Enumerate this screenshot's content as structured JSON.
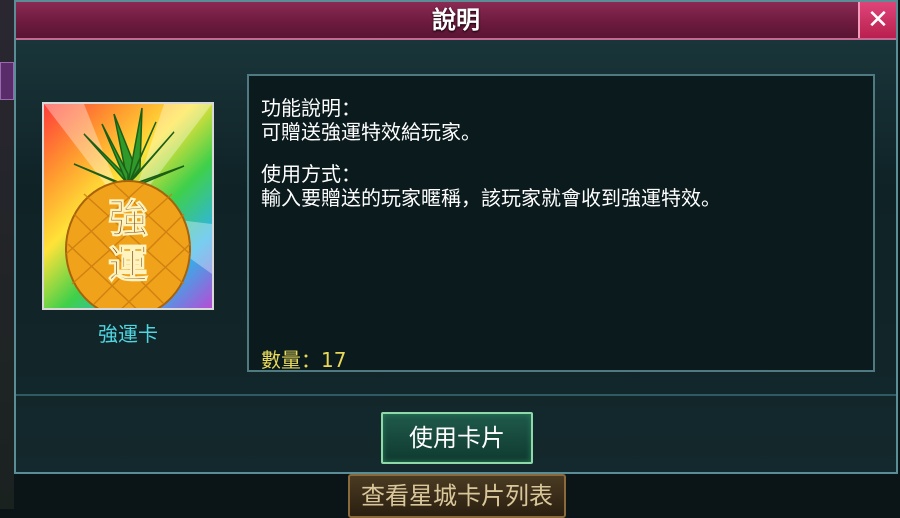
{
  "dialog": {
    "title": "說明",
    "close_label": "✕"
  },
  "item": {
    "name": "強運卡",
    "icon": "pineapple-card-icon",
    "icon_text": "強運"
  },
  "description": {
    "function_heading": "功能說明：",
    "function_text": "可贈送強運特效給玩家。",
    "usage_heading": "使用方式：",
    "usage_text": "輸入要贈送的玩家暱稱，該玩家就會收到強運特效。",
    "quantity": "數量：17"
  },
  "actions": {
    "use_label": "使用卡片"
  },
  "background": {
    "bottom_button_label": "查看星城卡片列表"
  },
  "colors": {
    "titlebar": "#6e1b3f",
    "close_button": "#d0326a",
    "item_name": "#4fd6e0",
    "quantity": "#e8d85a",
    "use_button_border": "#8fd9a8"
  }
}
